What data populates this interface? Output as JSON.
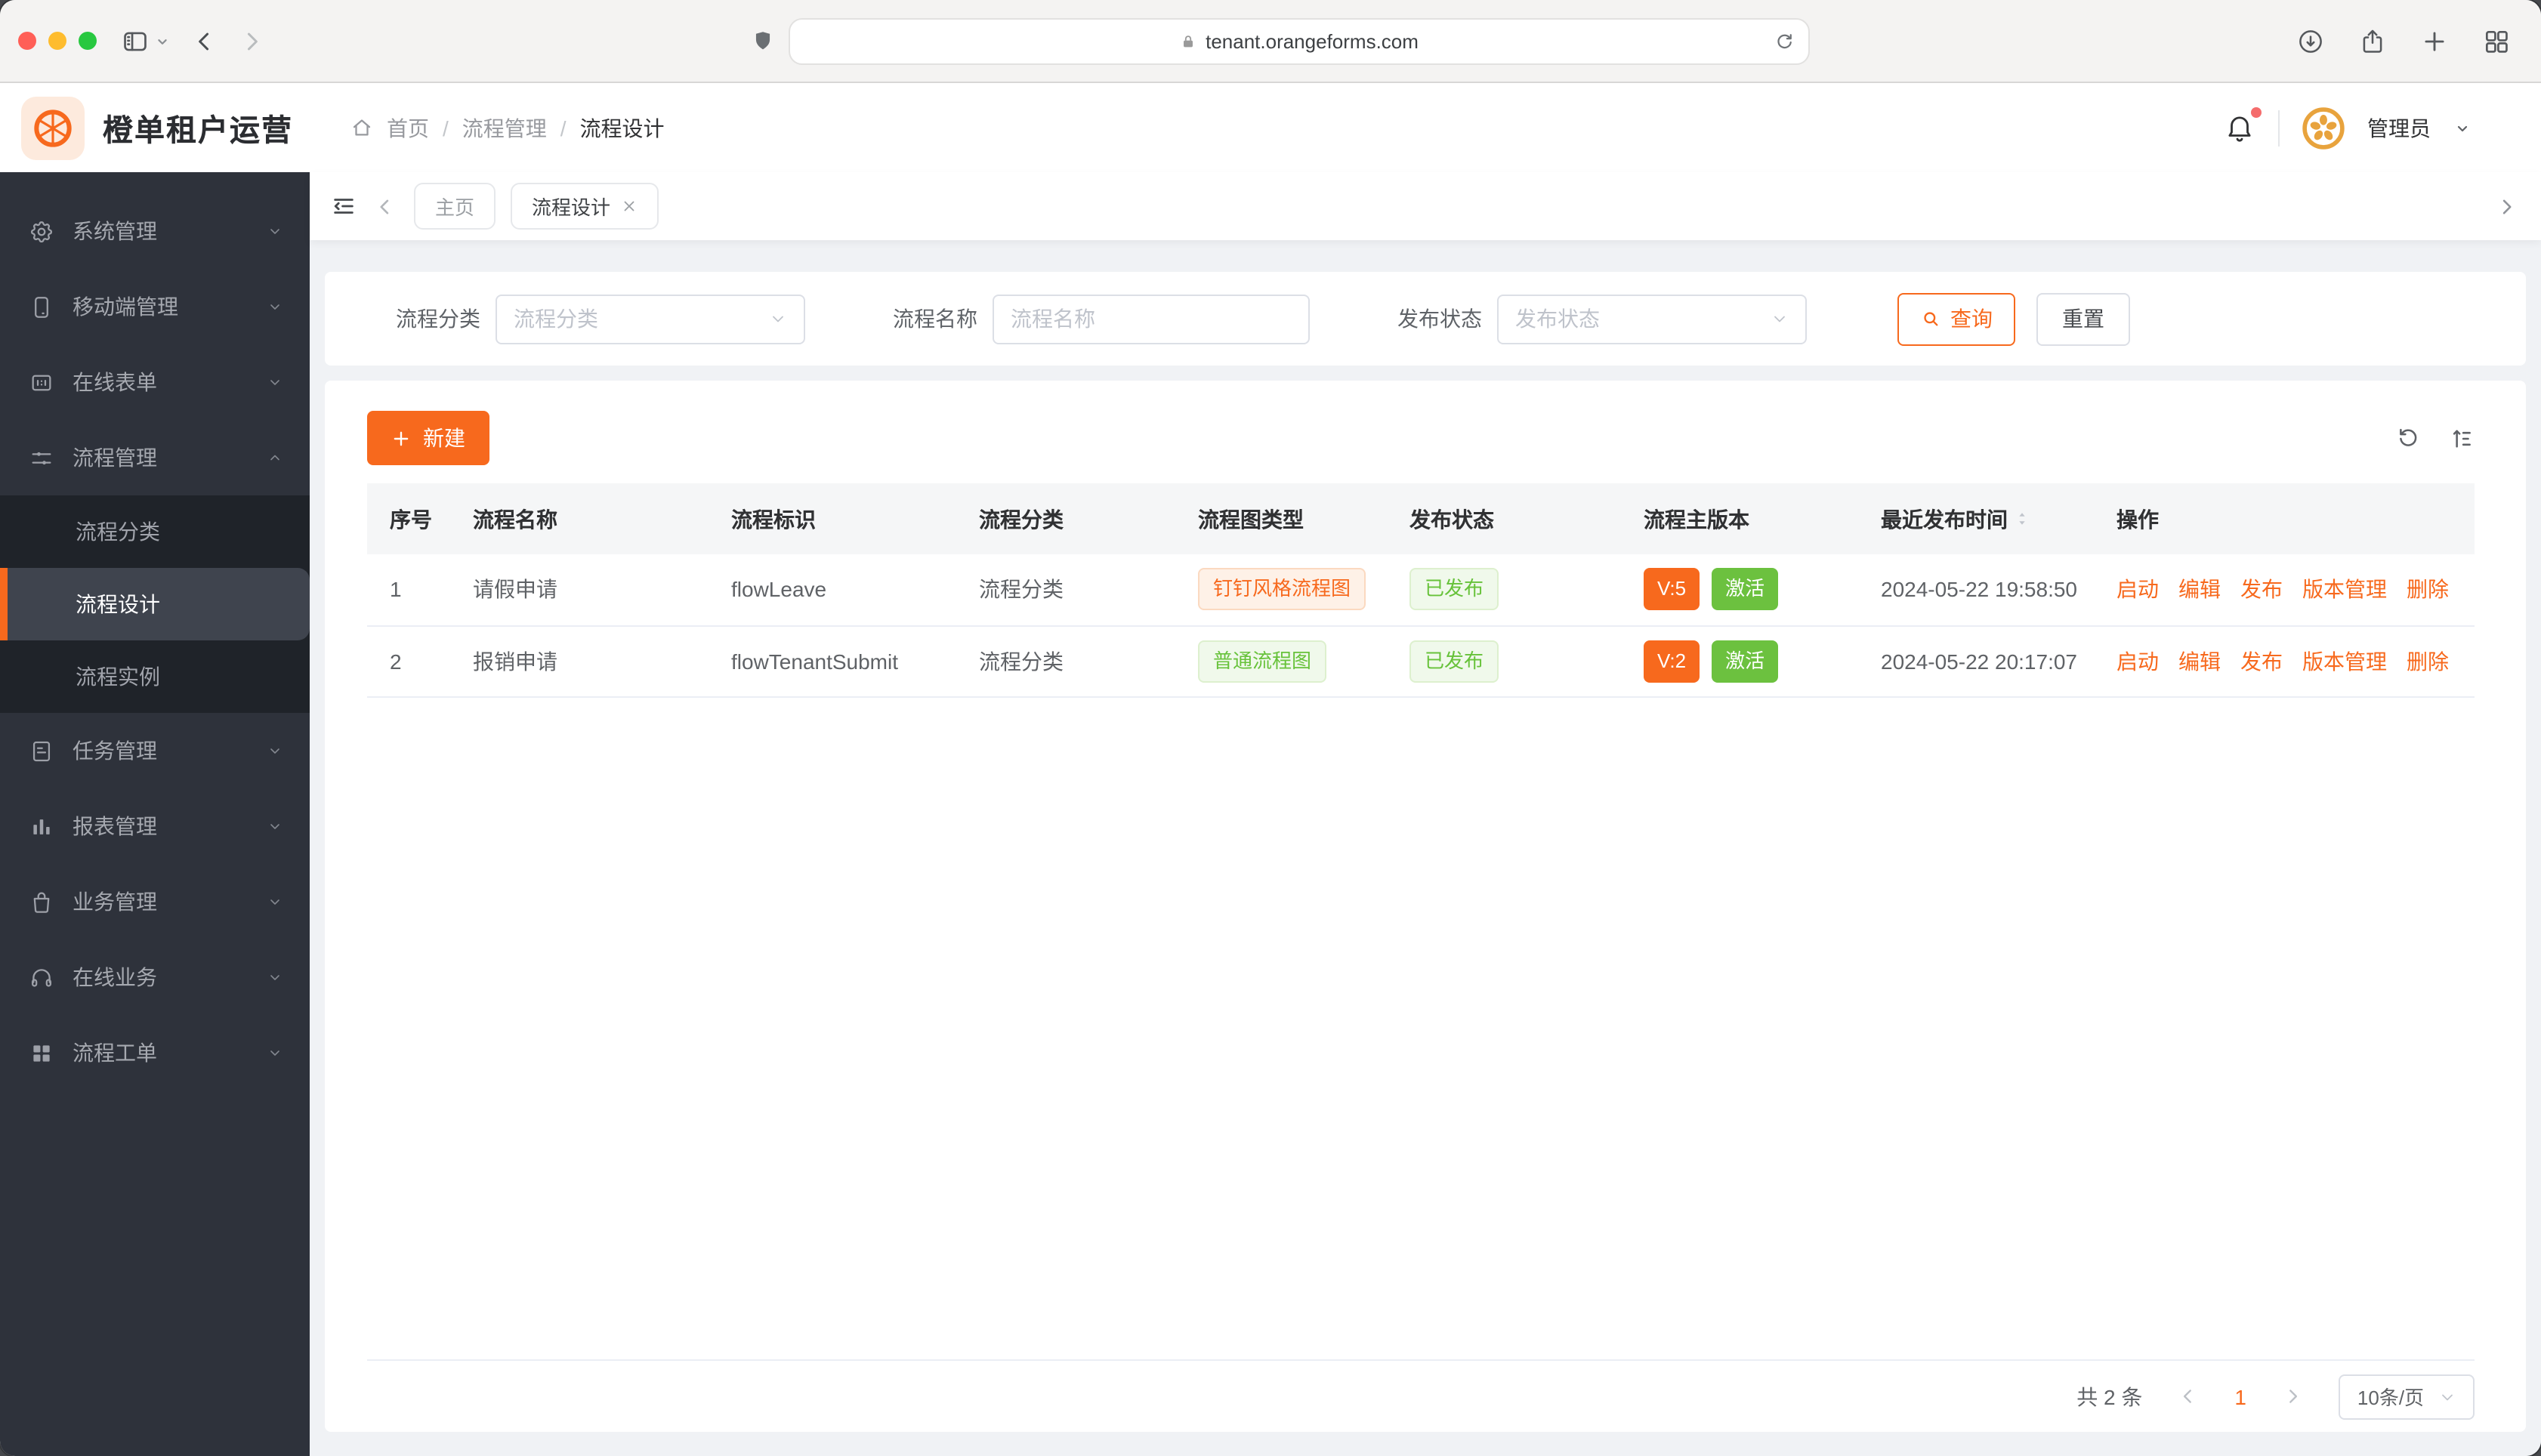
{
  "browser": {
    "url": "tenant.orangeforms.com"
  },
  "header": {
    "app_title": "橙单租户运营",
    "breadcrumb": {
      "home": "首页",
      "section": "流程管理",
      "current": "流程设计"
    },
    "user_name": "管理员"
  },
  "sidebar": {
    "items": [
      {
        "label": "系统管理",
        "icon": "gear-icon",
        "expanded": false
      },
      {
        "label": "移动端管理",
        "icon": "mobile-icon",
        "expanded": false
      },
      {
        "label": "在线表单",
        "icon": "form-icon",
        "expanded": false
      },
      {
        "label": "流程管理",
        "icon": "sliders-icon",
        "expanded": true,
        "children": [
          {
            "label": "流程分类",
            "active": false
          },
          {
            "label": "流程设计",
            "active": true
          },
          {
            "label": "流程实例",
            "active": false
          }
        ]
      },
      {
        "label": "任务管理",
        "icon": "document-icon",
        "expanded": false
      },
      {
        "label": "报表管理",
        "icon": "bar-chart-icon",
        "expanded": false
      },
      {
        "label": "业务管理",
        "icon": "bag-icon",
        "expanded": false
      },
      {
        "label": "在线业务",
        "icon": "headset-icon",
        "expanded": false
      },
      {
        "label": "流程工单",
        "icon": "grid-icon",
        "expanded": false
      }
    ]
  },
  "tabs": {
    "items": [
      {
        "label": "主页",
        "active": false,
        "closable": false
      },
      {
        "label": "流程设计",
        "active": true,
        "closable": true
      }
    ]
  },
  "filters": {
    "category_label": "流程分类",
    "category_placeholder": "流程分类",
    "name_label": "流程名称",
    "name_placeholder": "流程名称",
    "status_label": "发布状态",
    "status_placeholder": "发布状态",
    "query_label": "查询",
    "reset_label": "重置"
  },
  "table": {
    "create_label": "新建",
    "columns": [
      {
        "label": "序号"
      },
      {
        "label": "流程名称"
      },
      {
        "label": "流程标识"
      },
      {
        "label": "流程分类"
      },
      {
        "label": "流程图类型"
      },
      {
        "label": "发布状态"
      },
      {
        "label": "流程主版本"
      },
      {
        "label": "最近发布时间",
        "sortable": true
      },
      {
        "label": "操作"
      }
    ],
    "rows": [
      {
        "index": "1",
        "name": "请假申请",
        "key": "flowLeave",
        "category": "流程分类",
        "diagram_tag": {
          "text": "钉钉风格流程图",
          "style": "orange"
        },
        "status_tag": "已发布",
        "version": "V:5",
        "state": "激活",
        "published_at": "2024-05-22 19:58:50"
      },
      {
        "index": "2",
        "name": "报销申请",
        "key": "flowTenantSubmit",
        "category": "流程分类",
        "diagram_tag": {
          "text": "普通流程图",
          "style": "green"
        },
        "status_tag": "已发布",
        "version": "V:2",
        "state": "激活",
        "published_at": "2024-05-22 20:17:07"
      }
    ],
    "actions": [
      "启动",
      "编辑",
      "发布",
      "版本管理",
      "删除"
    ]
  },
  "pagination": {
    "total_label": "共 2 条",
    "current_page": "1",
    "page_size_label": "10条/页"
  },
  "colors": {
    "primary": "#F7691D",
    "success": "#67C23A"
  }
}
